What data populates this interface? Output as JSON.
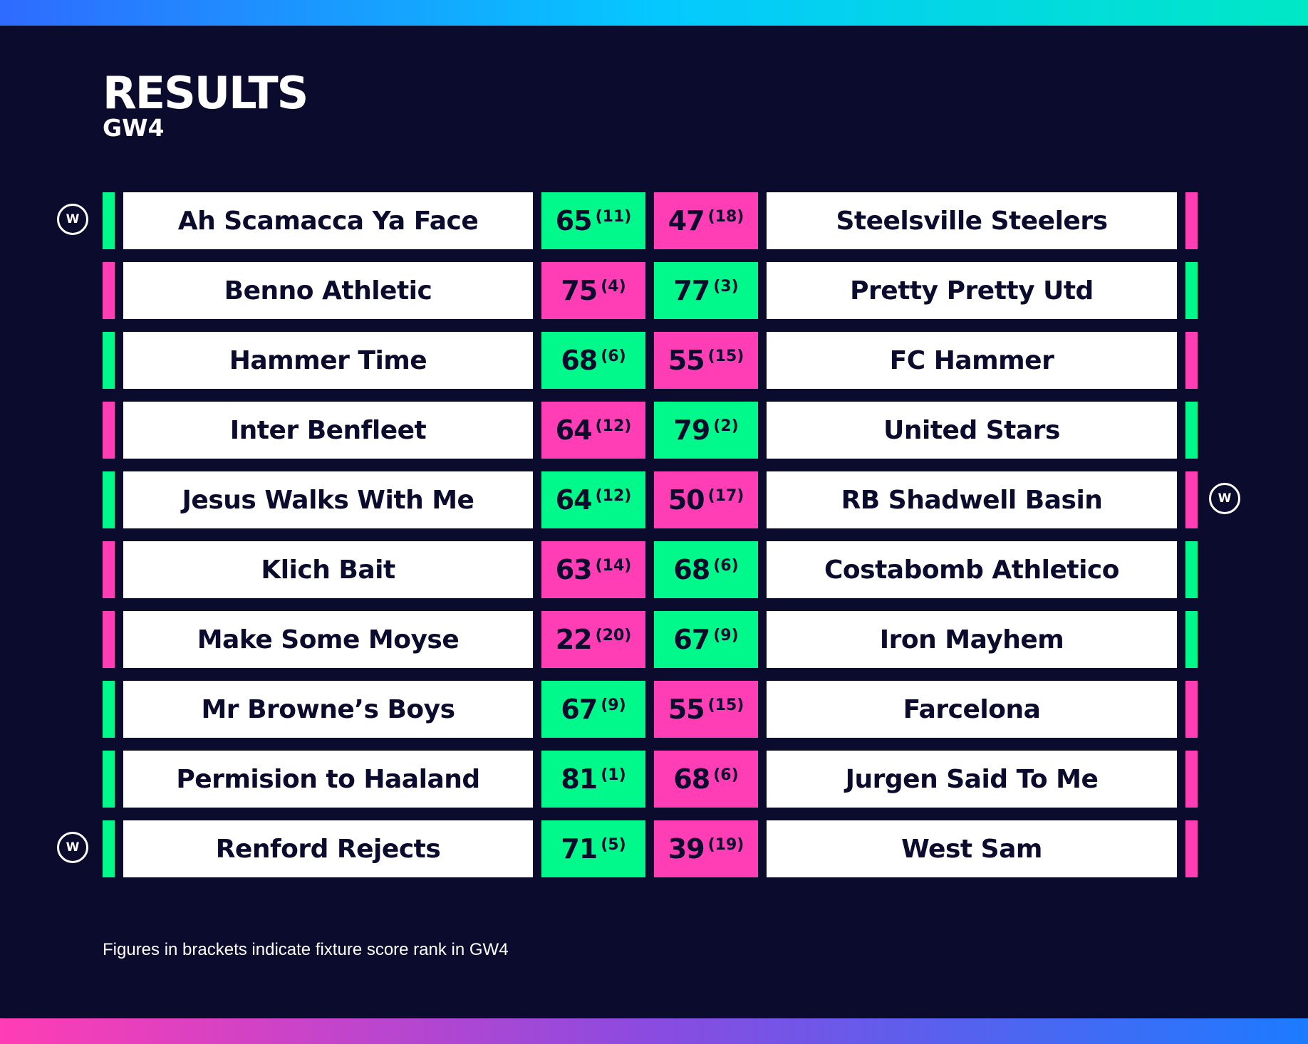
{
  "header": {
    "title": "RESULTS",
    "subtitle": "GW4"
  },
  "colors": {
    "background": "#0b0b2e",
    "winner": "#00f98a",
    "loser": "#ff3db4",
    "card": "#ffffff",
    "text_dark": "#0b0b2e"
  },
  "win_badge_label": "W",
  "fixtures": [
    {
      "home": {
        "team": "Ah Scamacca Ya Face",
        "score": "65",
        "rank": "(11)",
        "result": "win"
      },
      "away": {
        "team": "Steelsville Steelers",
        "score": "47",
        "rank": "(18)",
        "result": "loss"
      },
      "badge": "left"
    },
    {
      "home": {
        "team": "Benno Athletic",
        "score": "75",
        "rank": "(4)",
        "result": "loss"
      },
      "away": {
        "team": "Pretty Pretty Utd",
        "score": "77",
        "rank": "(3)",
        "result": "win"
      },
      "badge": ""
    },
    {
      "home": {
        "team": "Hammer Time",
        "score": "68",
        "rank": "(6)",
        "result": "win"
      },
      "away": {
        "team": "FC Hammer",
        "score": "55",
        "rank": "(15)",
        "result": "loss"
      },
      "badge": ""
    },
    {
      "home": {
        "team": "Inter Benfleet",
        "score": "64",
        "rank": "(12)",
        "result": "loss"
      },
      "away": {
        "team": "United Stars",
        "score": "79",
        "rank": "(2)",
        "result": "win"
      },
      "badge": ""
    },
    {
      "home": {
        "team": "Jesus Walks With Me",
        "score": "64",
        "rank": "(12)",
        "result": "win"
      },
      "away": {
        "team": "RB Shadwell Basin",
        "score": "50",
        "rank": "(17)",
        "result": "loss"
      },
      "badge": "right"
    },
    {
      "home": {
        "team": "Klich Bait",
        "score": "63",
        "rank": "(14)",
        "result": "loss"
      },
      "away": {
        "team": "Costabomb Athletico",
        "score": "68",
        "rank": "(6)",
        "result": "win"
      },
      "badge": ""
    },
    {
      "home": {
        "team": "Make Some Moyse",
        "score": "22",
        "rank": "(20)",
        "result": "loss"
      },
      "away": {
        "team": "Iron Mayhem",
        "score": "67",
        "rank": "(9)",
        "result": "win"
      },
      "badge": ""
    },
    {
      "home": {
        "team": "Mr Browne’s Boys",
        "score": "67",
        "rank": "(9)",
        "result": "win"
      },
      "away": {
        "team": "Farcelona",
        "score": "55",
        "rank": "(15)",
        "result": "loss"
      },
      "badge": ""
    },
    {
      "home": {
        "team": "Permision to Haaland",
        "score": "81",
        "rank": "(1)",
        "result": "win"
      },
      "away": {
        "team": "Jurgen Said To Me",
        "score": "68",
        "rank": "(6)",
        "result": "loss"
      },
      "badge": ""
    },
    {
      "home": {
        "team": "Renford Rejects",
        "score": "71",
        "rank": "(5)",
        "result": "win"
      },
      "away": {
        "team": "West Sam",
        "score": "39",
        "rank": "(19)",
        "result": "loss"
      },
      "badge": "left"
    }
  ],
  "footnote": "Figures in brackets indicate fixture score rank in GW4"
}
